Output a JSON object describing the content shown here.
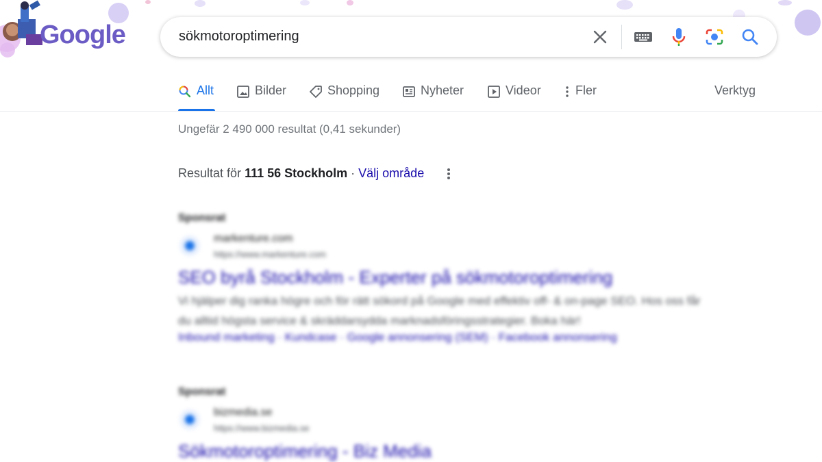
{
  "colors": {
    "accent": "#1a73e8",
    "link": "#1a0dab",
    "text": "#202124",
    "muted": "#70757a"
  },
  "logo": {
    "text": "Google"
  },
  "search": {
    "query": "sökmotoroptimering",
    "icons": [
      "close-icon",
      "keyboard-icon",
      "mic-icon",
      "camera-icon",
      "search-icon"
    ]
  },
  "tabs": [
    {
      "label": "Allt",
      "icon": "search-icon",
      "active": true
    },
    {
      "label": "Bilder",
      "icon": "image-icon"
    },
    {
      "label": "Shopping",
      "icon": "tag-icon"
    },
    {
      "label": "Nyheter",
      "icon": "news-icon"
    },
    {
      "label": "Videor",
      "icon": "play-icon"
    },
    {
      "label": "Fler",
      "icon": "more-vert-icon"
    }
  ],
  "tools_label": "Verktyg",
  "result_stats": "Ungefär 2 490 000 resultat (0,41 sekunder)",
  "location": {
    "prefix": "Resultat för",
    "place": "111 56 Stockholm",
    "separator": " · ",
    "change": "Välj område"
  },
  "ads": [
    {
      "label": "Sponsrat",
      "site": "markenture.com",
      "url": "https://www.markenture.com",
      "title": "SEO byrå Stockholm - Experter på sökmotoroptimering",
      "desc": "Vi hjälper dig ranka högre och för rätt sökord på Google med effektiv off- & on-page SEO. Hos oss får du alltid högsta service & skräddarsydda marknadsföringsstrategier. Boka här!",
      "links": "Inbound marketing · Kundcase · Google annonsering (SEM) · Facebook annonsering"
    },
    {
      "label": "Sponsrat",
      "site": "bizmedia.se",
      "url": "https://www.bizmedia.se",
      "title": "Sökmotoroptimering - Biz Media"
    }
  ]
}
